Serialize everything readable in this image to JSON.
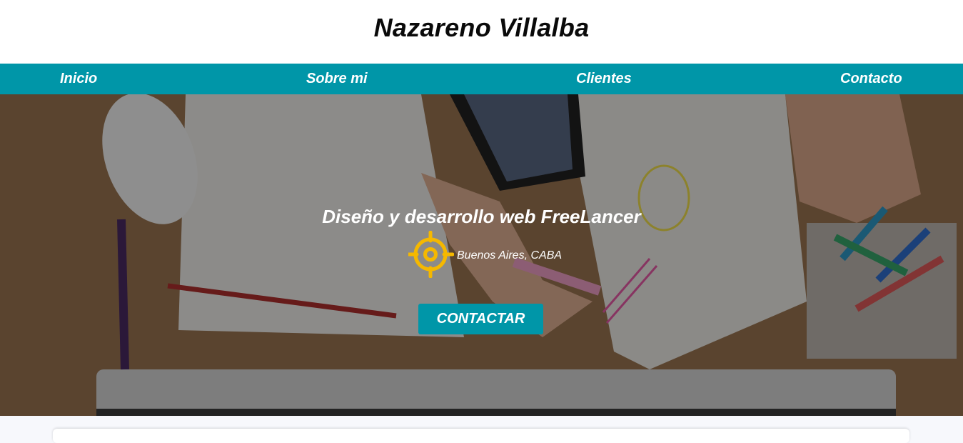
{
  "header": {
    "title": "Nazareno Villalba"
  },
  "nav": {
    "items": [
      {
        "label": "Inicio"
      },
      {
        "label": "Sobre mi"
      },
      {
        "label": "Clientes"
      },
      {
        "label": "Contacto"
      }
    ]
  },
  "hero": {
    "headline": "Diseño y desarrollo web FreeLancer",
    "location": "Buenos Aires, CABA",
    "location_icon": "target-location-icon",
    "cta_label": "CONTACTAR",
    "background": "desk-workspace-photo"
  },
  "colors": {
    "accent": "#0096a8",
    "icon": "#f5b800",
    "header_bg": "#ffffff",
    "text_light": "#ffffff"
  }
}
